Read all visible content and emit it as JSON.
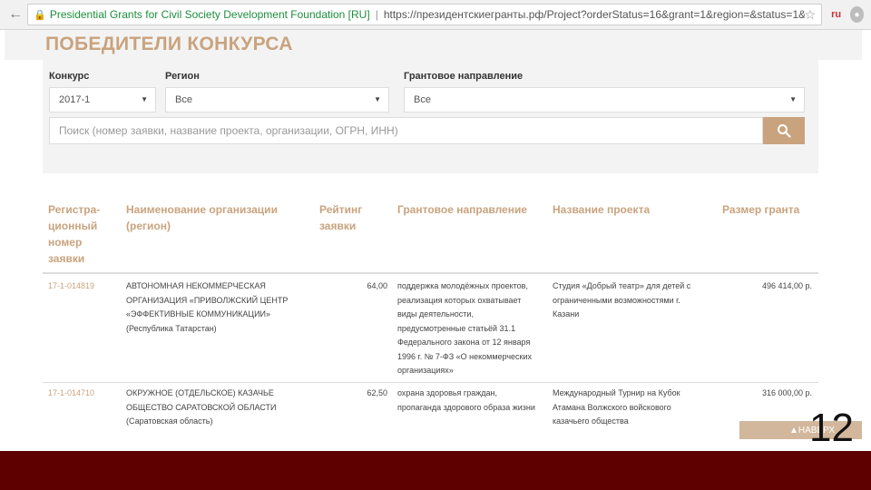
{
  "browser": {
    "site_name": "Presidential Grants for Civil Society Development Foundation [RU]",
    "url": "https://президентскиегранты.рф/Project?orderStatus=16&grant=1&region=&status=1&k=&pageNum...",
    "ext_label": "ru"
  },
  "page": {
    "title": "ПОБЕДИТЕЛИ КОНКУРСА"
  },
  "filters": {
    "contest_label": "Конкурс",
    "contest_value": "2017-1",
    "region_label": "Регион",
    "region_value": "Все",
    "direction_label": "Грантовое направление",
    "direction_value": "Все",
    "search_placeholder": "Поиск (номер заявки, название проекта, организации, ОГРН, ИНН)"
  },
  "table": {
    "headers": [
      "Регистра-ционный номер заявки",
      "Наименование организации (регион)",
      "Рейтинг заявки",
      "Грантовое направление",
      "Название проекта",
      "Размер гранта"
    ],
    "rows": [
      {
        "reg": "17-1-014819",
        "org": "АВТОНОМНАЯ НЕКОММЕРЧЕСКАЯ ОРГАНИЗАЦИЯ «ПРИВОЛЖСКИЙ ЦЕНТР «ЭФФЕКТИВНЫЕ КОММУНИКАЦИИ» (Республика Татарстан)",
        "rating": "64,00",
        "direction": "поддержка молодёжных проектов, реализация которых охватывает виды деятельности, предусмотренные статьёй 31.1 Федерального закона от 12 января 1996 г. № 7-ФЗ «О некоммерческих организациях»",
        "project": "Студия «Добрый театр» для детей с ограниченными возможностями г. Казани",
        "amount": "496 414,00 р."
      },
      {
        "reg": "17-1-014710",
        "org": "ОКРУЖНОЕ (ОТДЕЛЬСКОЕ) КАЗАЧЬЕ ОБЩЕСТВО САРАТОВСКОЙ ОБЛАСТИ (Саратовская область)",
        "rating": "62,50",
        "direction": "охрана здоровья граждан, пропаганда здорового образа жизни",
        "project": "Международный Турнир на Кубок Атамана Волжского войскового казачьего общества",
        "amount": "316 000,00 р."
      }
    ]
  },
  "top_button_label": "НАВЕРХ",
  "slide_number": "12",
  "colors": {
    "accent": "#c9a37e",
    "footer": "#5e0000",
    "panel": "#f3f3f3"
  }
}
